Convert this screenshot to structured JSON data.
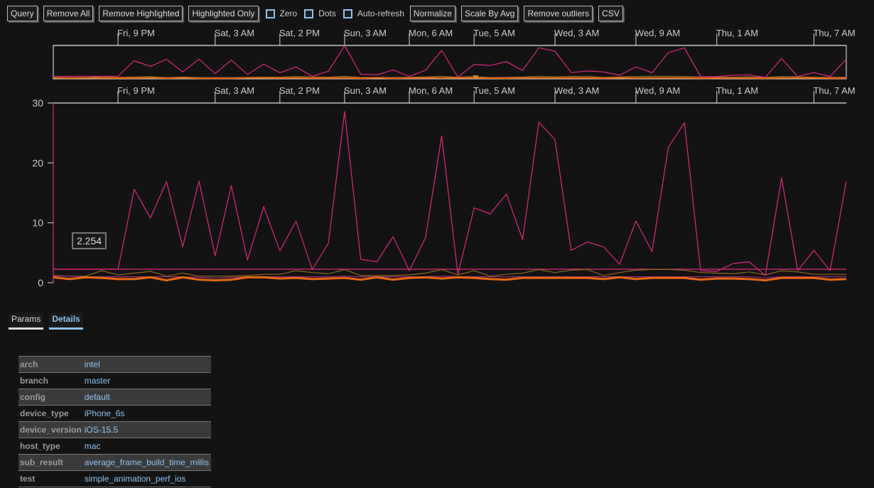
{
  "toolbar": {
    "buttons": [
      "Query",
      "Remove All",
      "Remove Highlighted",
      "Highlighted Only"
    ],
    "checkboxes": [
      {
        "label": "Zero",
        "checked": false
      },
      {
        "label": "Dots",
        "checked": false
      },
      {
        "label": "Auto-refresh",
        "checked": false
      }
    ],
    "buttons2": [
      "Normalize",
      "Scale By Avg",
      "Remove outliers",
      "CSV"
    ]
  },
  "tooltip": {
    "value": "2.254"
  },
  "tabs": [
    {
      "label": "Params",
      "active": false
    },
    {
      "label": "Details",
      "active": true
    }
  ],
  "details": [
    {
      "key": "arch",
      "value": "intel"
    },
    {
      "key": "branch",
      "value": "master"
    },
    {
      "key": "config",
      "value": "default"
    },
    {
      "key": "device_type",
      "value": "iPhone_6s"
    },
    {
      "key": "device_version",
      "value": "iOS-15.5"
    },
    {
      "key": "host_type",
      "value": "mac"
    },
    {
      "key": "sub_result",
      "value": "average_frame_build_time_millis"
    },
    {
      "key": "test",
      "value": "simple_animation_perf_ios"
    }
  ],
  "colors": {
    "background": "#131313",
    "axis": "#dddddd",
    "accent": "#8ec2ef",
    "highlight_series": "#e0287d",
    "orange_series": "#e8690c",
    "olive_series": "#8a6a1c",
    "purple_series": "#a0307a"
  },
  "chart_data": {
    "type": "line",
    "title": "",
    "xlabel": "",
    "ylabel": "",
    "ylim": [
      0,
      30
    ],
    "yticks": [
      0,
      10,
      20,
      30
    ],
    "xtick_labels": [
      "Fri, 9 PM",
      "Sat, 3 AM",
      "Sat, 2 PM",
      "Sun, 3 AM",
      "Mon, 6 AM",
      "Tue, 5 AM",
      "Wed, 3 AM",
      "Wed, 9 AM",
      "Thu, 1 AM",
      "Thu, 7 AM"
    ],
    "xtick_index": [
      4,
      10,
      14,
      18,
      22,
      26,
      31,
      36,
      41,
      47
    ],
    "point_count": 50,
    "reference_line": 2.254,
    "grid": false,
    "legend": "none",
    "series": [
      {
        "name": "highlighted",
        "color": "#e0287d",
        "width": 1.2,
        "values": [
          2.25,
          2.25,
          2.25,
          2.25,
          2.25,
          15.6,
          10.8,
          16.9,
          6.0,
          17.0,
          4.5,
          16.2,
          3.8,
          12.7,
          5.3,
          10.3,
          2.2,
          6.6,
          28.6,
          3.9,
          3.5,
          7.7,
          2.0,
          7.5,
          24.5,
          1.4,
          12.5,
          11.5,
          14.8,
          7.2,
          26.8,
          23.9,
          5.4,
          6.8,
          6.0,
          3.1,
          10.3,
          5.2,
          22.6,
          26.7,
          2.0,
          1.9,
          3.2,
          3.5,
          1.2,
          17.5,
          2.0,
          5.4,
          2.0,
          16.9
        ]
      },
      {
        "name": "olive",
        "color": "#8a6a1c",
        "width": 1.2,
        "values": [
          1.2,
          1.1,
          1.1,
          2.0,
          1.3,
          1.6,
          1.9,
          1.1,
          1.6,
          1.1,
          1.1,
          1.1,
          1.2,
          1.4,
          1.4,
          2.0,
          1.7,
          1.5,
          2.2,
          1.2,
          1.2,
          1.2,
          1.3,
          1.6,
          2.2,
          1.3,
          2.0,
          1.1,
          1.4,
          1.6,
          2.2,
          1.7,
          2.1,
          2.2,
          1.2,
          1.7,
          2.1,
          2.2,
          2.2,
          2.1,
          1.7,
          1.6,
          1.5,
          1.8,
          1.3,
          2.0,
          1.8,
          1.4,
          1.4,
          1.4
        ]
      },
      {
        "name": "purple",
        "color": "#a0307a",
        "width": 1.2,
        "values": [
          1.1,
          1.1,
          1.0,
          1.0,
          1.0,
          1.0,
          1.0,
          1.0,
          1.0,
          0.9,
          0.8,
          0.9,
          1.0,
          1.0,
          1.0,
          1.0,
          1.0,
          1.0,
          1.1,
          1.0,
          1.0,
          1.0,
          1.0,
          1.0,
          1.1,
          1.0,
          1.0,
          1.0,
          1.0,
          1.0,
          1.0,
          1.0,
          1.0,
          1.0,
          1.0,
          1.0,
          1.0,
          1.0,
          1.0,
          1.0,
          1.0,
          1.0,
          1.0,
          1.0,
          0.8,
          1.0,
          1.0,
          1.0,
          1.0,
          1.0
        ]
      },
      {
        "name": "orange",
        "color": "#e8690c",
        "width": 3,
        "values": [
          0.9,
          0.6,
          0.9,
          0.8,
          0.6,
          0.6,
          0.9,
          0.4,
          0.9,
          0.5,
          0.4,
          0.5,
          0.9,
          0.9,
          0.7,
          0.8,
          0.6,
          0.7,
          0.8,
          0.5,
          0.9,
          0.5,
          0.8,
          0.9,
          0.7,
          0.9,
          0.8,
          0.6,
          0.5,
          0.8,
          0.8,
          0.8,
          0.8,
          0.8,
          0.6,
          0.9,
          0.6,
          0.8,
          0.8,
          0.8,
          0.5,
          0.7,
          0.7,
          0.6,
          0.4,
          0.8,
          0.8,
          0.8,
          0.5,
          0.6
        ]
      }
    ]
  }
}
